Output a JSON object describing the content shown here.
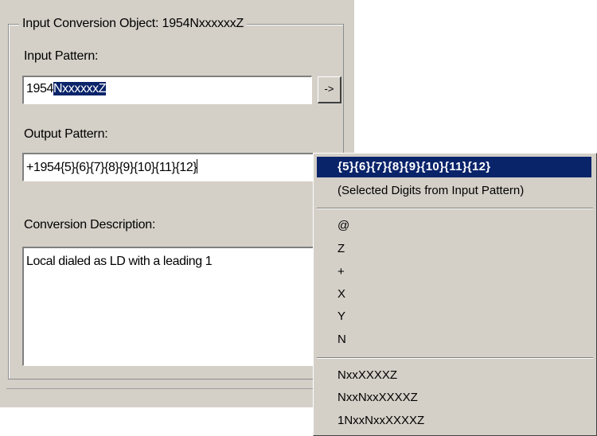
{
  "dialog": {
    "group_title": "Input Conversion Object:  1954NxxxxxxZ",
    "input_label": "Input Pattern:",
    "input_value_plain": "1954",
    "input_value_selected": "NxxxxxxZ",
    "arrow_button": "->",
    "output_label": "Output Pattern:",
    "output_value": "+1954{5}{6}{7}{8}{9}{10}{11}{12}",
    "description_label": "Conversion Description:",
    "description_value": "Local dialed as LD with a leading 1"
  },
  "menu": {
    "items": [
      "{5}{6}{7}{8}{9}{10}{11}{12}",
      "(Selected Digits from Input Pattern)",
      "@",
      "Z",
      "+",
      "X",
      "Y",
      "N",
      "NxxXXXXZ",
      "NxxNxxXXXXZ",
      "1NxxNxxXXXXZ"
    ],
    "highlight_color": "#0a246a"
  }
}
